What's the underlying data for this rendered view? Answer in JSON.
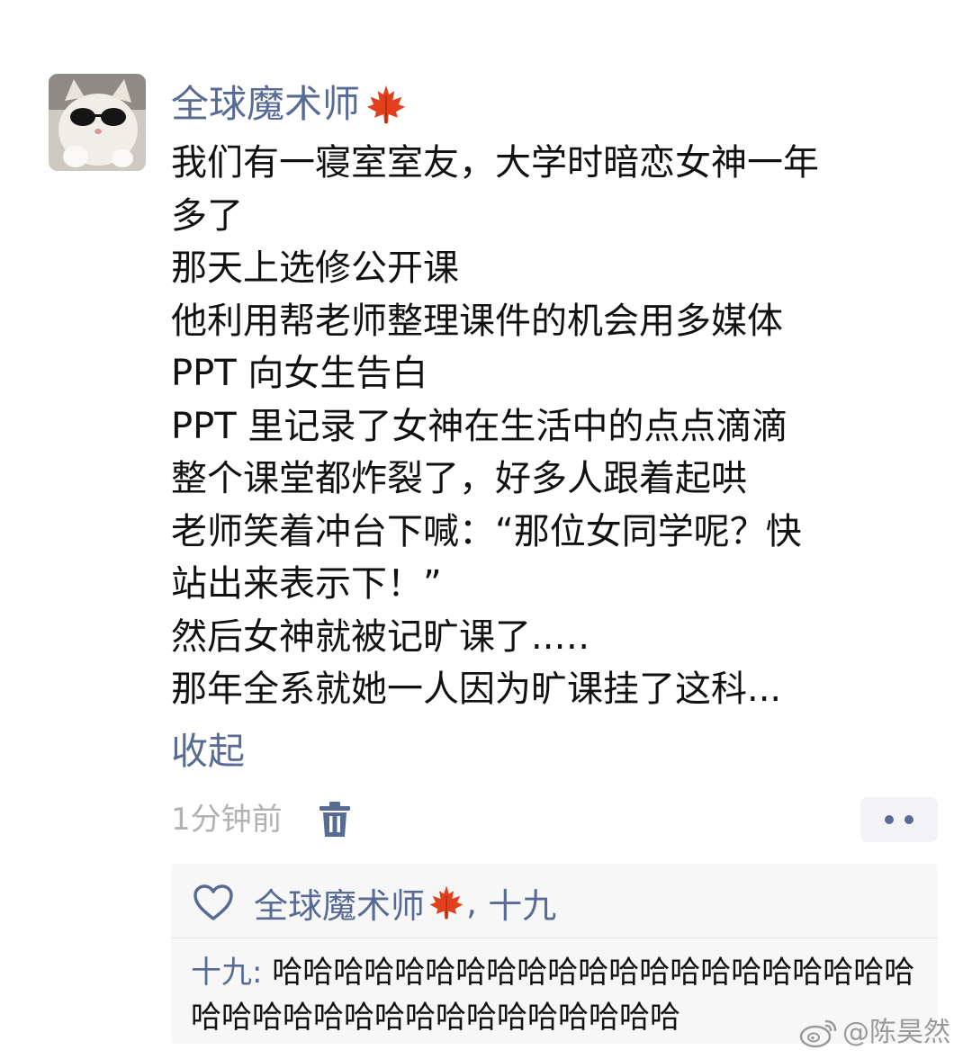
{
  "post": {
    "username": "全球魔术师",
    "username_emoji": "maple-leaf",
    "lines": [
      "我们有一寝室室友，大学时暗恋女神一年",
      "多了",
      "那天上选修公开课",
      "他利用帮老师整理课件的机会用多媒体",
      "PPT 向女生告白",
      "PPT 里记录了女神在生活中的点点滴滴",
      "整个课堂都炸裂了，好多人跟着起哄",
      "老师笑着冲台下喊：“那位女同学呢？快",
      "站出来表示下！”",
      "然后女神就被记旷课了..…",
      "那年全系就她一人因为旷课挂了这科..."
    ],
    "collapse_label": "收起",
    "timestamp": "1分钟前"
  },
  "likes": {
    "first_name": "全球魔术师",
    "separator": ", ",
    "second_name": "十九"
  },
  "comment": {
    "author": "十九",
    "colon": ": ",
    "text": "哈哈哈哈哈哈哈哈哈哈哈哈哈哈哈哈哈哈哈哈哈哈哈哈哈哈哈哈哈哈哈哈哈哈哈哈哈"
  },
  "watermark": {
    "text": "@陈昊然"
  },
  "colors": {
    "link_blue": "#576b95",
    "time_gray": "#b2b2b2",
    "panel_bg": "#f7f7f7",
    "maple_red": "#e0401c"
  }
}
